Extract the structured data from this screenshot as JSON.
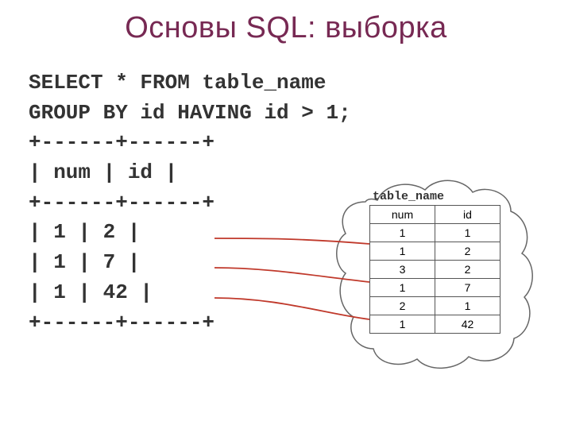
{
  "title": "Основы SQL: выборка",
  "sql": {
    "line1": "SELECT * FROM table_name",
    "line2": "  GROUP BY id HAVING id > 1;"
  },
  "result_ascii": {
    "sep1": "+------+------+",
    "head": "| num  | id   |",
    "sep2": "+------+------+",
    "r1": "|    1 |    2 |",
    "r2": "|    1 |    7 |",
    "r3": "|    1 |   42 |",
    "sep3": "+------+------+"
  },
  "source_table": {
    "label": "table_name",
    "headers": [
      "num",
      "id"
    ],
    "rows": [
      [
        "1",
        "1"
      ],
      [
        "1",
        "2"
      ],
      [
        "3",
        "2"
      ],
      [
        "1",
        "7"
      ],
      [
        "2",
        "1"
      ],
      [
        "1",
        "42"
      ]
    ]
  },
  "chart_data": {
    "type": "table",
    "title": "table_name",
    "columns": [
      "num",
      "id"
    ],
    "rows": [
      [
        1,
        1
      ],
      [
        1,
        2
      ],
      [
        3,
        2
      ],
      [
        1,
        7
      ],
      [
        2,
        1
      ],
      [
        1,
        42
      ]
    ]
  }
}
